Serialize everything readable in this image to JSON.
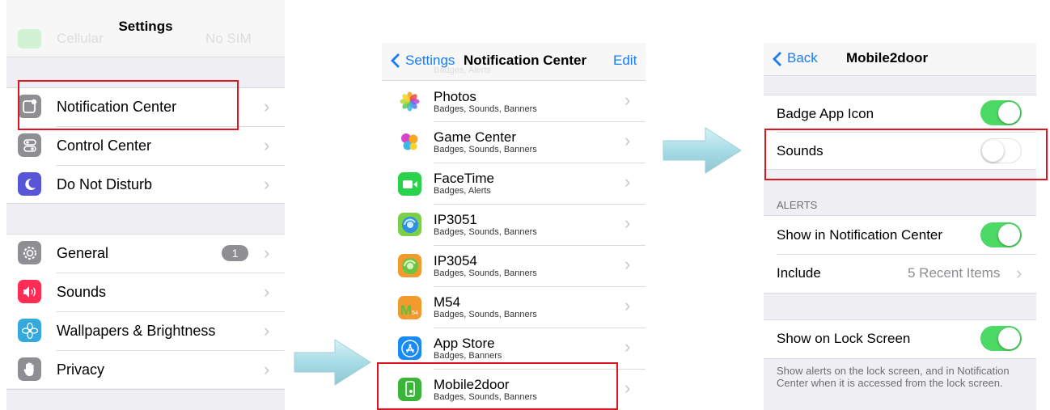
{
  "settings": {
    "title": "Settings",
    "cellular_ghost": "Cellular",
    "no_sim_ghost": "No SIM",
    "items": [
      {
        "label": "Notification Center"
      },
      {
        "label": "Control Center"
      },
      {
        "label": "Do Not Disturb"
      },
      {
        "label": "General",
        "badge": "1"
      },
      {
        "label": "Sounds"
      },
      {
        "label": "Wallpapers & Brightness"
      },
      {
        "label": "Privacy"
      }
    ]
  },
  "notification_center": {
    "back_label": "Settings",
    "title": "Notification Center",
    "edit_label": "Edit",
    "ghost_top": "Badges, Alerts",
    "apps": [
      {
        "name": "Photos",
        "sub": "Badges, Sounds, Banners"
      },
      {
        "name": "Game Center",
        "sub": "Badges, Sounds, Banners"
      },
      {
        "name": "FaceTime",
        "sub": "Badges, Alerts"
      },
      {
        "name": "IP3051",
        "sub": "Badges, Sounds, Banners"
      },
      {
        "name": "IP3054",
        "sub": "Badges, Sounds, Banners"
      },
      {
        "name": "M54",
        "sub": "Badges, Sounds, Banners",
        "icon_text": "M",
        "icon_sub": "54"
      },
      {
        "name": "App Store",
        "sub": "Badges, Banners"
      },
      {
        "name": "Mobile2door",
        "sub": "Badges, Sounds, Banners"
      }
    ]
  },
  "mobile2door": {
    "back_label": "Back",
    "title": "Mobile2door",
    "badge_app_icon": "Badge App Icon",
    "badge_app_icon_on": true,
    "sounds": "Sounds",
    "sounds_on": false,
    "alerts_header": "ALERTS",
    "show_in_nc": "Show in Notification Center",
    "show_in_nc_on": true,
    "include": "Include",
    "include_value": "5 Recent Items",
    "show_lock": "Show on Lock Screen",
    "show_lock_on": true,
    "footer": "Show alerts on the lock screen, and in Notification Center when it is accessed from the lock screen."
  },
  "colors": {
    "toggle_on": "#4cd964",
    "ios_blue": "#1a7cf4",
    "highlight": "#e0141e",
    "arrow": "#a8dce6"
  },
  "icons": {
    "notification_center": "notification-center-icon",
    "control_center": "control-center-icon",
    "do_not_disturb": "moon-icon",
    "general": "gear-icon",
    "sounds": "speaker-icon",
    "wallpapers": "flower-icon",
    "privacy": "hand-icon"
  }
}
